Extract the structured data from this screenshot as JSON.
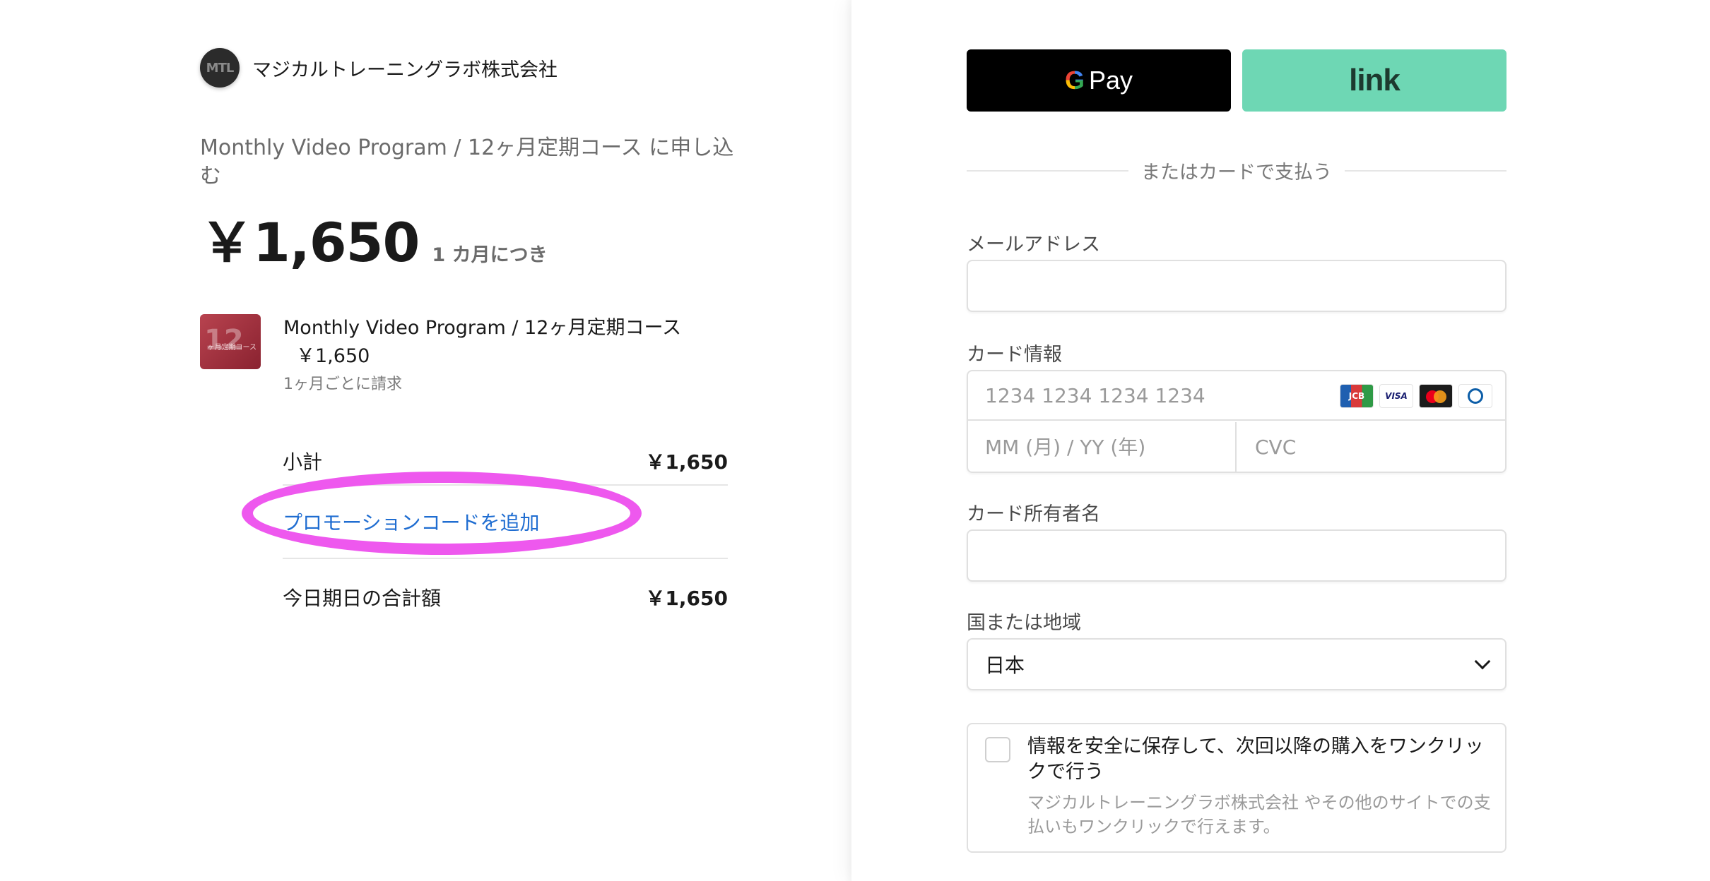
{
  "merchant": {
    "logo_text": "MTL",
    "name": "マジカルトレーニングラボ株式会社"
  },
  "summary_header": {
    "subscribe_title": "Monthly Video Program / 12ヶ月定期コース に申し込む",
    "price": "￥1,650",
    "period": "1 カ月につき"
  },
  "product": {
    "thumbnail_number": "12",
    "thumbnail_caption": "ヶ月定期コース",
    "name": "Monthly Video Program / 12ヶ月定期コース",
    "price": "￥1,650",
    "billing": "1ヶ月ごとに請求"
  },
  "totals": {
    "subtotal_label": "小計",
    "subtotal_value": "￥1,650",
    "promo_label": "プロモーションコードを追加",
    "total_label": "今日期日の合計額",
    "total_value": "￥1,650"
  },
  "payment": {
    "gpay_g": "G",
    "gpay_label": "Pay",
    "link_label": "link",
    "or_text": "またはカードで支払う",
    "email_label": "メールアドレス",
    "email_value": "",
    "card_label": "カード情報",
    "card_number_placeholder": "1234 1234 1234 1234",
    "expiry_placeholder": "MM (月) / YY (年)",
    "cvc_placeholder": "CVC",
    "card_brands": [
      "JCB",
      "VISA"
    ],
    "cardholder_label": "カード所有者名",
    "cardholder_value": "",
    "country_label": "国または地域",
    "country_value": "日本",
    "save_title": "情報を安全に保存して、次回以降の購入をワンクリックで行う",
    "save_desc": "マジカルトレーニングラボ株式会社 やその他のサイトでの支払いもワンクリックで行えます。"
  },
  "colors": {
    "accent_link": "#1f6dd1",
    "link_button": "#6ed7b4",
    "annotation": "#ee58ee"
  }
}
